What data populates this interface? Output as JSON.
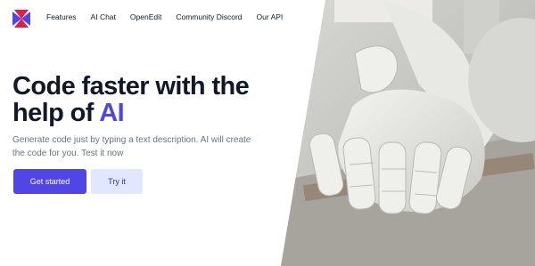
{
  "nav": {
    "logo_icon": "diamond-x-logo-icon",
    "links": [
      "Features",
      "AI Chat",
      "OpenEdit",
      "Community Discord",
      "Our API"
    ]
  },
  "hero": {
    "headline_part1": "Code faster with the",
    "headline_part2": "help of ",
    "headline_accent": "AI",
    "subtext": "Generate code just by typing a text description. AI will create the code for you. Test it now",
    "primary_cta": "Get started",
    "secondary_cta": "Try it"
  },
  "colors": {
    "accent": "#4f46e5",
    "secondary_bg": "#e0e7ff",
    "text": "#111827",
    "muted": "#6b7280"
  }
}
